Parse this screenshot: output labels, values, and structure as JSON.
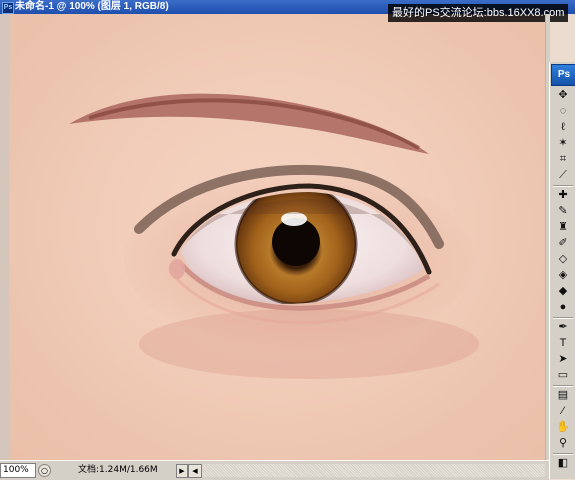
{
  "window": {
    "ps_badge": "Ps",
    "title": "未命名-1 @ 100% (图层 1, RGB/8)"
  },
  "watermark": {
    "text": "最好的PS交流论坛:bbs.16XX8.com"
  },
  "canvas": {
    "subject": "painted eye"
  },
  "toolbox": {
    "logo": "Ps",
    "tools": [
      {
        "name": "move-tool-icon",
        "glyph": "✥"
      },
      {
        "name": "marquee-tool-icon",
        "glyph": "◌"
      },
      {
        "name": "lasso-tool-icon",
        "glyph": "ℓ"
      },
      {
        "name": "magic-wand-tool-icon",
        "glyph": "✶"
      },
      {
        "name": "crop-tool-icon",
        "glyph": "⌗"
      },
      {
        "name": "slice-tool-icon",
        "glyph": "⟋"
      },
      {
        "name": "healing-brush-tool-icon",
        "glyph": "✚"
      },
      {
        "name": "brush-tool-icon",
        "glyph": "✎"
      },
      {
        "name": "clone-stamp-tool-icon",
        "glyph": "♜"
      },
      {
        "name": "history-brush-tool-icon",
        "glyph": "✐"
      },
      {
        "name": "eraser-tool-icon",
        "glyph": "◇"
      },
      {
        "name": "paint-bucket-tool-icon",
        "glyph": "◈"
      },
      {
        "name": "blur-tool-icon",
        "glyph": "◆"
      },
      {
        "name": "dodge-tool-icon",
        "glyph": "●"
      },
      {
        "name": "pen-tool-icon",
        "glyph": "✒"
      },
      {
        "name": "type-tool-icon",
        "glyph": "T"
      },
      {
        "name": "path-selection-tool-icon",
        "glyph": "➤"
      },
      {
        "name": "shape-tool-icon",
        "glyph": "▭"
      },
      {
        "name": "notes-tool-icon",
        "glyph": "▤"
      },
      {
        "name": "eyedropper-tool-icon",
        "glyph": "⁄"
      },
      {
        "name": "hand-tool-icon",
        "glyph": "✋"
      },
      {
        "name": "zoom-tool-icon",
        "glyph": "⚲"
      },
      {
        "name": "color-swatches-icon",
        "glyph": "◧"
      }
    ]
  },
  "statusbar": {
    "zoom": "100%",
    "doc_info": "文档:1.24M/1.66M",
    "arrow": "▶",
    "scroll_left": "◀"
  },
  "colors": {
    "titlebar": "#1f4fae",
    "skin": "#f1cdb9",
    "iris": "#9a5a14",
    "chrome": "#d4d0c8"
  }
}
